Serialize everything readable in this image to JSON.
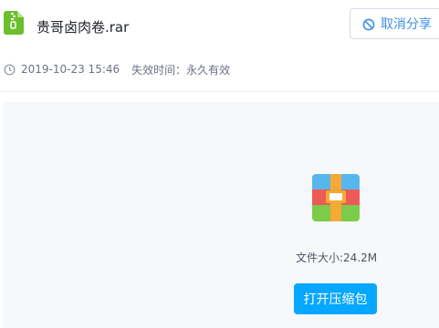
{
  "header": {
    "file_name": "贵哥卤肉卷.rar",
    "file_icon": "zip-file-icon",
    "cancel_share_label": "取消分享",
    "cancel_share_icon": "ban-icon"
  },
  "meta": {
    "clock_icon": "clock-icon",
    "share_time": "2019-10-23 15:46",
    "expire_text": "失效时间：永久有效"
  },
  "preview": {
    "archive_icon": "archive-icon",
    "file_size": "文件大小:24.2M",
    "open_button_label": "打开压缩包"
  },
  "colors": {
    "accent": "#06a7ff",
    "link": "#3b91e8",
    "file_icon_green": "#6bbf2a"
  }
}
